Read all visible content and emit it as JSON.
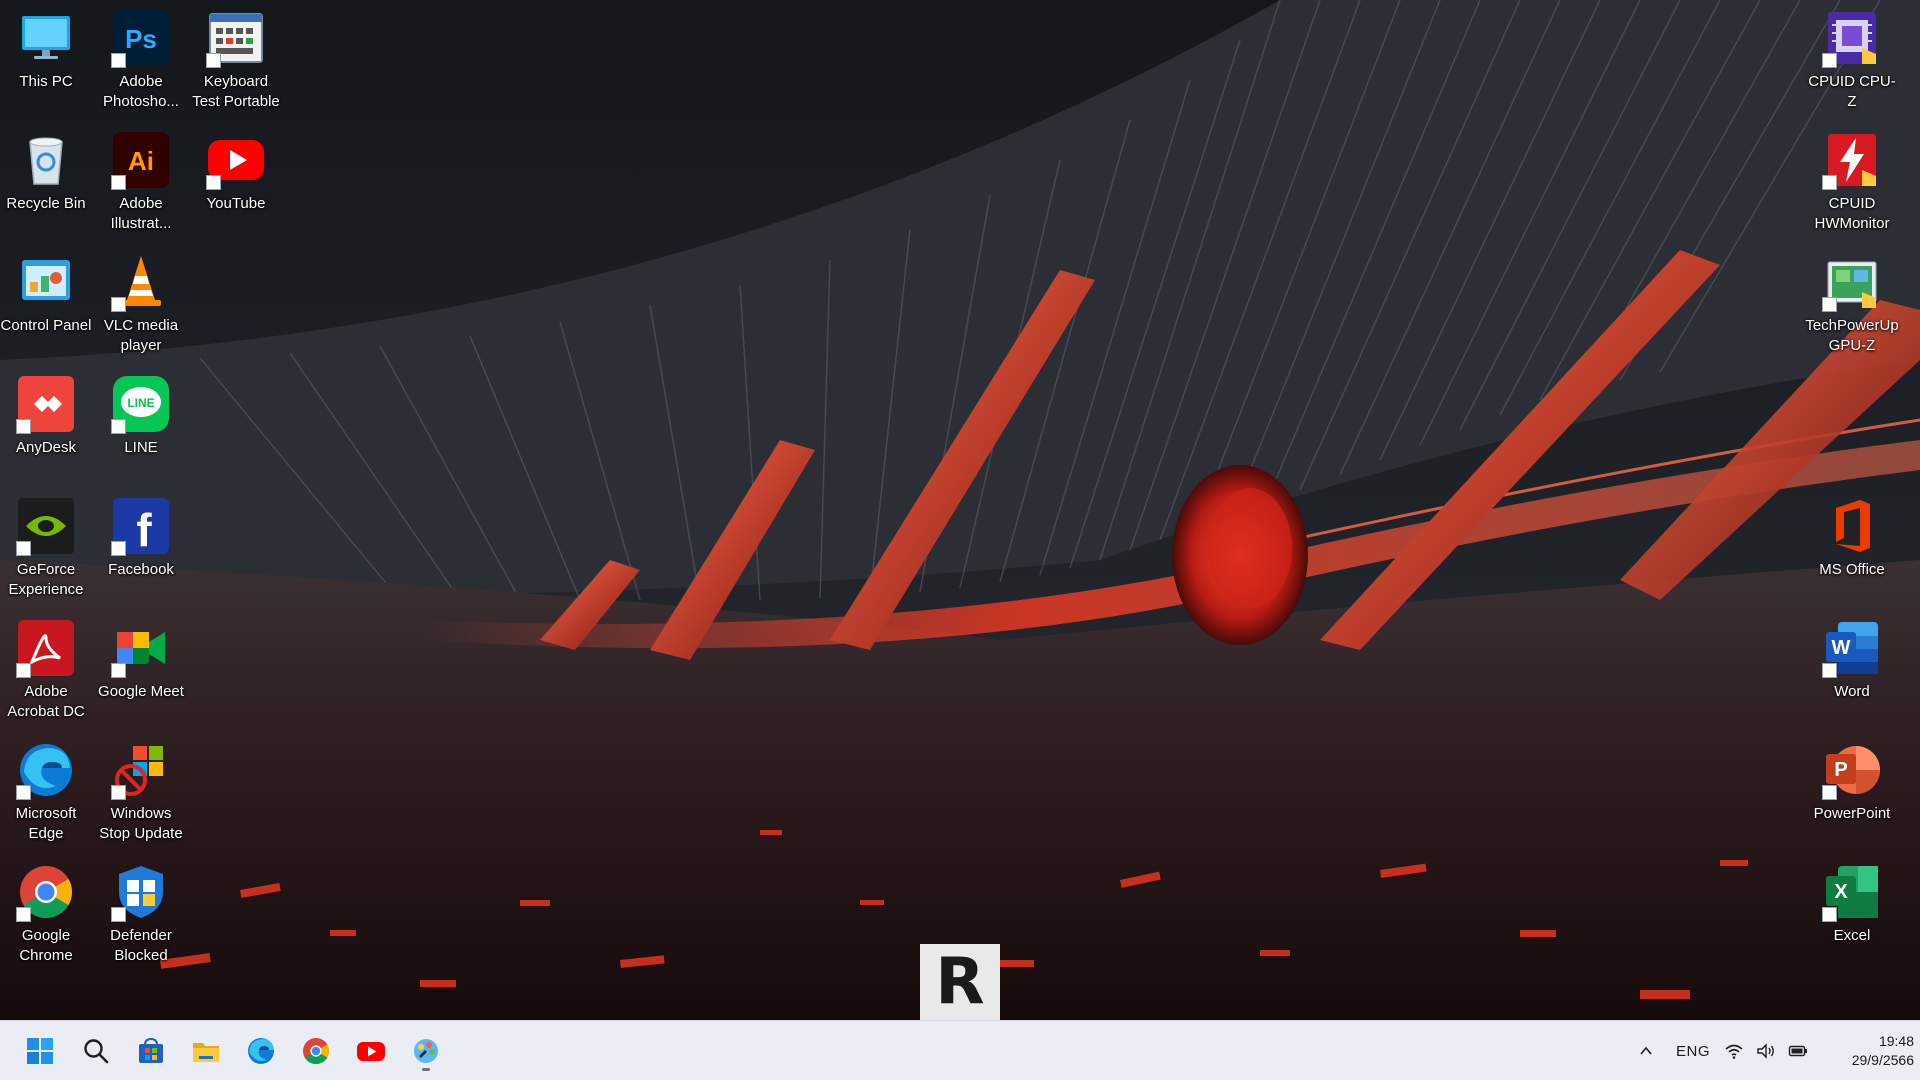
{
  "desktop": {
    "icons": [
      {
        "label": "This PC",
        "icon": "monitor-icon"
      },
      {
        "label": "Adobe Photosho...",
        "icon": "photoshop-icon"
      },
      {
        "label": "Keyboard Test Portable",
        "icon": "keyboard-test-icon"
      },
      {
        "label": "Recycle Bin",
        "icon": "recycle-bin-icon"
      },
      {
        "label": "Adobe Illustrat...",
        "icon": "illustrator-icon"
      },
      {
        "label": "YouTube",
        "icon": "youtube-icon"
      },
      {
        "label": "Control Panel",
        "icon": "control-panel-icon"
      },
      {
        "label": "VLC media player",
        "icon": "vlc-cone-icon"
      },
      {
        "label": "AnyDesk",
        "icon": "anydesk-icon"
      },
      {
        "label": "LINE",
        "icon": "line-icon"
      },
      {
        "label": "GeForce Experience",
        "icon": "geforce-icon"
      },
      {
        "label": "Facebook",
        "icon": "facebook-icon"
      },
      {
        "label": "Adobe Acrobat DC",
        "icon": "acrobat-icon"
      },
      {
        "label": "Google Meet",
        "icon": "google-meet-icon"
      },
      {
        "label": "Microsoft Edge",
        "icon": "edge-icon"
      },
      {
        "label": "Windows Stop Update",
        "icon": "windows-stop-update-icon"
      },
      {
        "label": "Google Chrome",
        "icon": "chrome-icon"
      },
      {
        "label": "Defender Blocked",
        "icon": "defender-icon"
      },
      {
        "label": "CPUID CPU-Z",
        "icon": "cpuz-icon"
      },
      {
        "label": "CPUID HWMonitor",
        "icon": "hwmonitor-icon"
      },
      {
        "label": "TechPowerUp GPU-Z",
        "icon": "gpuz-icon"
      },
      {
        "label": "MS Office",
        "icon": "office-icon"
      },
      {
        "label": "Word",
        "icon": "word-icon"
      },
      {
        "label": "PowerPoint",
        "icon": "powerpoint-icon"
      },
      {
        "label": "Excel",
        "icon": "excel-icon"
      }
    ]
  },
  "overlay": {
    "letter": "R"
  },
  "taskbar": {
    "pinned": [
      {
        "name": "start",
        "icon": "windows-start-icon"
      },
      {
        "name": "search",
        "icon": "search-icon"
      },
      {
        "name": "microsoft-store",
        "icon": "store-icon"
      },
      {
        "name": "file-explorer",
        "icon": "folder-icon"
      },
      {
        "name": "edge",
        "icon": "edge-icon"
      },
      {
        "name": "chrome",
        "icon": "chrome-icon"
      },
      {
        "name": "youtube",
        "icon": "youtube-icon"
      },
      {
        "name": "paint-app",
        "icon": "paint-icon"
      }
    ],
    "tray": {
      "language": "ENG",
      "icons": [
        "chevron-up-icon",
        "wifi-icon",
        "speaker-icon",
        "battery-icon"
      ],
      "time": "19:48",
      "date": "29/9/2566"
    }
  },
  "colors": {
    "taskbar_bg": "#eaeef4",
    "wallpaper_accent": "#e0281c",
    "label_text": "#ffffff"
  }
}
